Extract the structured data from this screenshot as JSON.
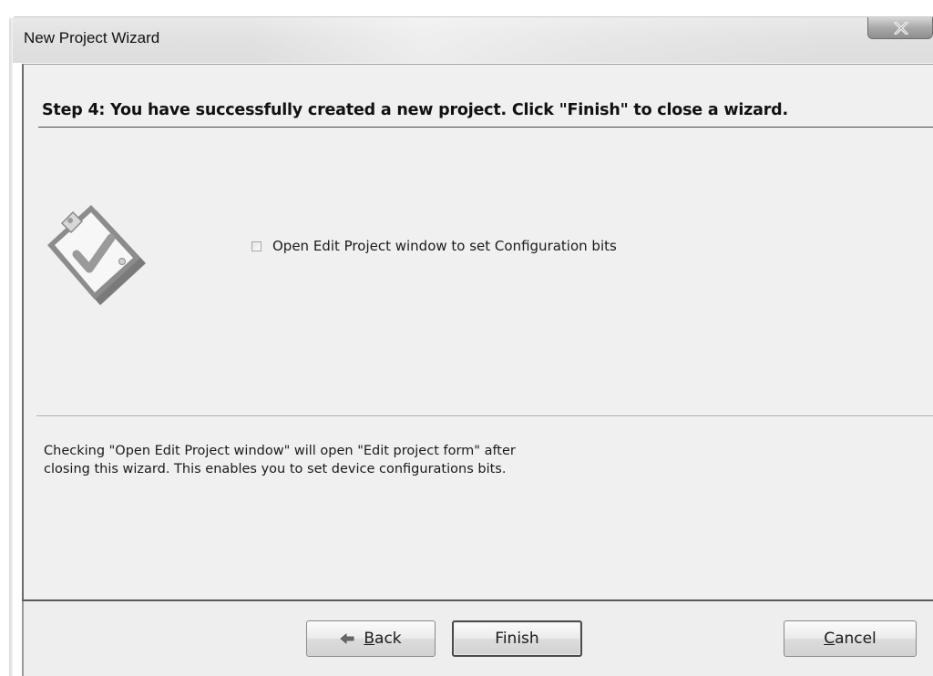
{
  "window": {
    "title": "New Project Wizard",
    "close_icon": "close-icon",
    "close_glyph": "x"
  },
  "step": {
    "heading": "Step 4: You have successfully created a new project.  Click \"Finish\" to close a wizard."
  },
  "icon": {
    "name": "clipboard-check-icon"
  },
  "option": {
    "checked": false,
    "label": "Open Edit Project window to set Configuration bits"
  },
  "help": {
    "line1": "Checking \"Open Edit Project window\" will open \"Edit project form\" after",
    "line2": "closing this wizard. This enables you to set device configurations bits."
  },
  "buttons": {
    "back": {
      "accel": "B",
      "rest": "ack",
      "icon": "back-arrow-icon"
    },
    "finish": {
      "label": "Finish"
    },
    "cancel": {
      "accel": "C",
      "rest": "ancel"
    }
  },
  "colors": {
    "dialog_bg": "#f0f0f0",
    "titlebar": "#e2e2e2",
    "text": "#111111"
  }
}
